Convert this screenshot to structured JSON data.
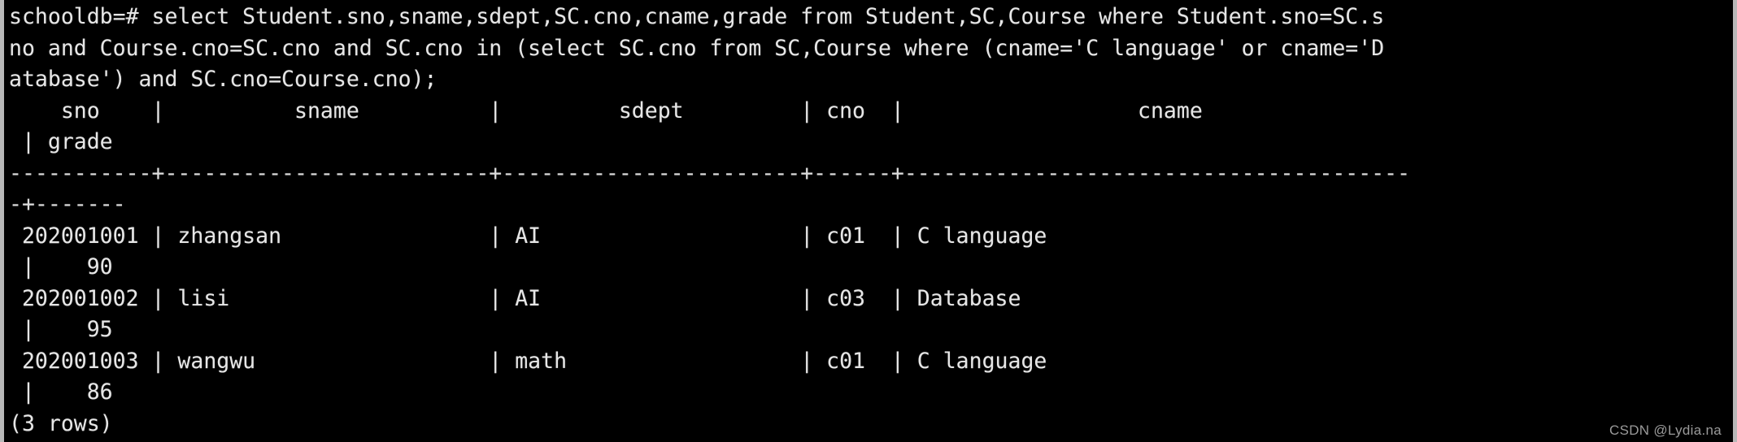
{
  "terminal": {
    "shell_prompt": "schooldb=#",
    "database": "schooldb",
    "query": "select Student.sno,sname,sdept,SC.cno,cname,grade from Student,SC,Course where Student.sno=SC.sno and Course.cno=SC.cno and SC.cno in (select SC.cno from SC,Course where (cname='C language' or cname='Database') and SC.cno=Course.cno);",
    "lines": [
      "schooldb=# select Student.sno,sname,sdept,SC.cno,cname,grade from Student,SC,Course where Student.sno=SC.s",
      "no and Course.cno=SC.cno and SC.cno in (select SC.cno from SC,Course where (cname='C language' or cname='D",
      "atabase') and SC.cno=Course.cno);",
      "    sno    |          sname          |         sdept         | cno  |                  cname                ",
      " | grade ",
      "-----------+-------------------------+-----------------------+------+---------------------------------------",
      "-+-------",
      " 202001001 | zhangsan                | AI                    | c01  | C language                            ",
      " |    90",
      " 202001002 | lisi                    | AI                    | c03  | Database                              ",
      " |    95",
      " 202001003 | wangwu                  | math                  | c01  | C language                            ",
      " |    86",
      "(3 rows)"
    ],
    "result_table": {
      "columns": [
        "sno",
        "sname",
        "sdept",
        "cno",
        "cname",
        "grade"
      ],
      "rows": [
        [
          "202001001",
          "zhangsan",
          "AI",
          "c01",
          "C language",
          "90"
        ],
        [
          "202001002",
          "lisi",
          "AI",
          "c03",
          "Database",
          "95"
        ],
        [
          "202001003",
          "wangwu",
          "math",
          "c01",
          "C language",
          "86"
        ]
      ],
      "row_count_label": "(3 rows)",
      "row_count": 3
    },
    "colors": {
      "background": "#000000",
      "foreground": "#e6e6e6",
      "window_border": "#b8b8b8",
      "watermark": "#9a9a9a"
    }
  },
  "watermark": {
    "text": "CSDN @Lydia.na"
  }
}
